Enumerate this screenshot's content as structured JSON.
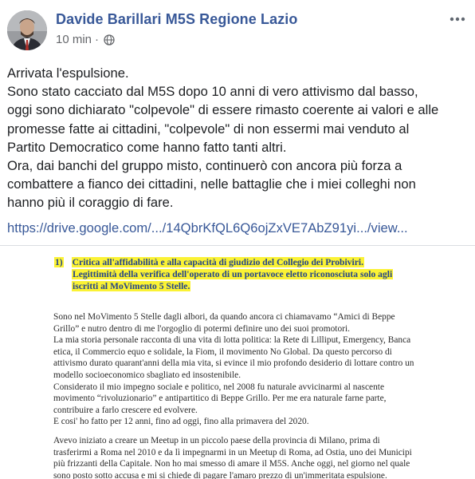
{
  "post": {
    "author": "Davide Barillari M5S Regione Lazio",
    "time": "10 min",
    "separator": "·",
    "privacy_icon": "globe-icon",
    "more_icon": "more-options-icon",
    "text_lines": [
      "Arrivata l'espulsione.",
      "Sono stato cacciato dal M5S dopo 10 anni di vero attivismo dal basso,",
      "oggi sono dichiarato \"colpevole\" di essere rimasto coerente ai valori e alle",
      "promesse fatte ai cittadini, \"colpevole\" di non essermi mai venduto al",
      "Partito Democratico come hanno fatto tanti altri.",
      "Ora, dai banchi del gruppo misto, continuerò con ancora più forza a",
      "combattere a fianco dei cittadini, nelle battaglie che i miei colleghi non",
      "hanno più il coraggio di fare."
    ],
    "link": "https://drive.google.com/.../14QbrKfQL6Q6ojZxVE7AbZ91yi.../view..."
  },
  "document": {
    "heading_number": "1)",
    "heading_lines": [
      "Critica all'affidabilità e alla capacità di giudizio del Collegio dei Probiviri.",
      "Legittimità della verifica dell'operato di un portavoce eletto riconosciuta solo agli",
      "iscritti al MoVimento 5 Stelle."
    ],
    "para1_lines": [
      "Sono nel MoVimento 5 Stelle dagli albori, da quando ancora ci chiamavamo “Amici di Beppe",
      "Grillo” e nutro dentro di me l'orgoglio di potermi definire uno dei suoi promotori.",
      "La mia storia personale racconta di una vita di lotta politica: la Rete di Lilliput, Emergency, Banca",
      "etica, il Commercio equo e solidale, la Fiom, il movimento No Global. Da questo percorso di",
      "attivismo durato quarant'anni della mia vita, si evince il mio profondo desiderio di lottare contro un",
      "modello socioeconomico sbagliato ed insostenibile.",
      "Considerato il mio impegno sociale e politico, nel 2008 fu naturale avvicinarmi al nascente",
      "movimento “rivoluzionario” e antipartitico di Beppe Grillo. Per me era naturale farne parte,",
      "contribuire a farlo crescere ed evolvere.",
      "E cosi' ho fatto per 12 anni, fino ad oggi, fino alla primavera del 2020."
    ],
    "para2_lines": [
      "Avevo iniziato a creare un Meetup in un piccolo paese della provincia di Milano, prima di",
      "trasferirmi a Roma nel 2010 e da lì impegnarmi in un Meetup di Roma, ad Ostia, uno dei Municipi",
      "più frizzanti della Capitale. Non ho mai smesso di amare il M5S. Anche oggi, nel giorno nel quale",
      "sono posto sotto accusa e mi si chiede di pagare l'amaro prezzo di un'immeritata espulsione."
    ]
  },
  "colors": {
    "author": "#385898",
    "link": "#385898",
    "meta": "#65676b",
    "highlight": "#fbf234",
    "doc_heading": "#24458a"
  }
}
